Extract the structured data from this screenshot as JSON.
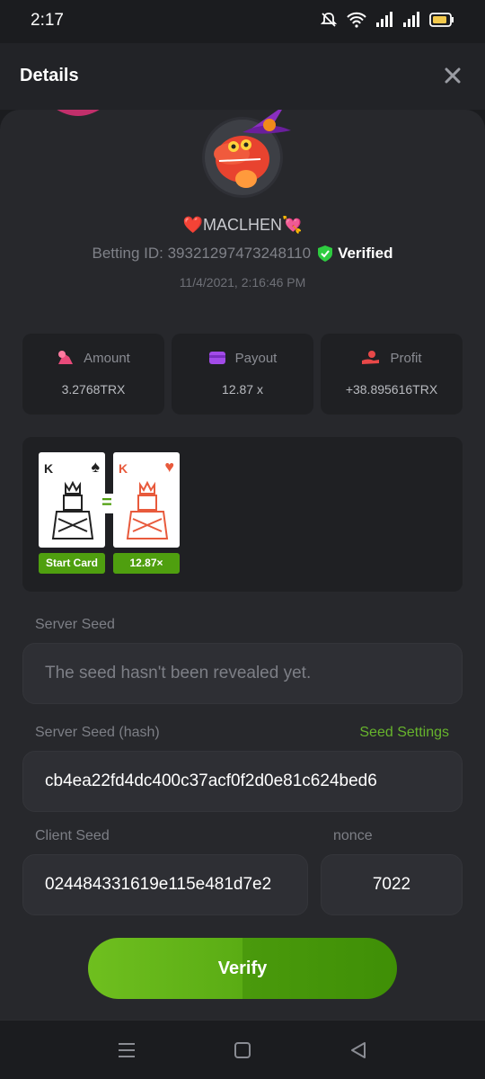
{
  "status": {
    "time": "2:17"
  },
  "header": {
    "title": "Details"
  },
  "user": {
    "name": "❤️MACLHEN💘",
    "betting_id_label": "Betting ID: 39321297473248110",
    "verified": "Verified",
    "datetime": "11/4/2021, 2:16:46 PM"
  },
  "stats": [
    {
      "label": "Amount",
      "value": "3.2768TRX",
      "icon": "money-bag-icon",
      "color": "#e84a7a"
    },
    {
      "label": "Payout",
      "value": "12.87 x",
      "icon": "wallet-icon",
      "color": "#a24be8"
    },
    {
      "label": "Profit",
      "value": "+38.895616TRX",
      "icon": "hand-coin-icon",
      "color": "#e84848"
    }
  ],
  "cards": {
    "start": {
      "rank": "K",
      "suit": "♠",
      "tag": "Start Card"
    },
    "next": {
      "rank": "K",
      "suit": "♥",
      "tag": "12.87×"
    },
    "operator": "="
  },
  "server_seed": {
    "label": "Server Seed",
    "value": "The seed hasn't been revealed yet."
  },
  "server_seed_hash": {
    "label": "Server Seed (hash)",
    "settings_link": "Seed Settings",
    "value": "cb4ea22fd4dc400c37acf0f2d0e81c624bed6"
  },
  "client_seed": {
    "label": "Client Seed",
    "value": "024484331619e115e481d7e2"
  },
  "nonce": {
    "label": "nonce",
    "value": "7022"
  },
  "verify_label": "Verify",
  "colors": {
    "accent": "#5aac14",
    "link": "#67b42c",
    "verified": "#2ecc40"
  }
}
